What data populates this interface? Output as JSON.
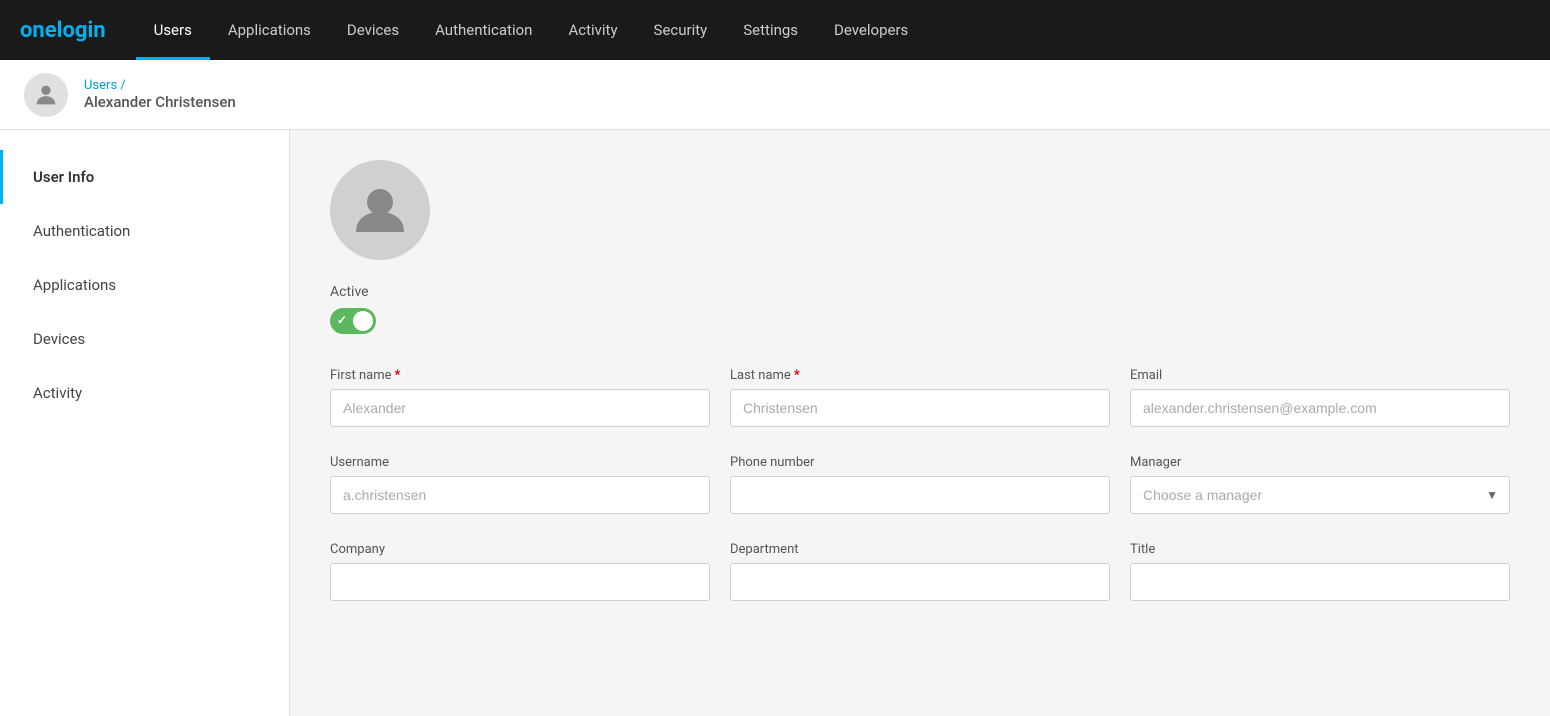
{
  "logo": {
    "text_one": "one",
    "text_two": "login"
  },
  "topnav": {
    "items": [
      {
        "id": "users",
        "label": "Users",
        "active": true
      },
      {
        "id": "applications",
        "label": "Applications",
        "active": false
      },
      {
        "id": "devices",
        "label": "Devices",
        "active": false
      },
      {
        "id": "authentication",
        "label": "Authentication",
        "active": false
      },
      {
        "id": "activity",
        "label": "Activity",
        "active": false
      },
      {
        "id": "security",
        "label": "Security",
        "active": false
      },
      {
        "id": "settings",
        "label": "Settings",
        "active": false
      },
      {
        "id": "developers",
        "label": "Developers",
        "active": false
      }
    ]
  },
  "breadcrumb": {
    "link_label": "Users /",
    "current_user": "Alexander Christensen"
  },
  "sidebar": {
    "items": [
      {
        "id": "user-info",
        "label": "User Info",
        "active": true
      },
      {
        "id": "authentication",
        "label": "Authentication",
        "active": false
      },
      {
        "id": "applications",
        "label": "Applications",
        "active": false
      },
      {
        "id": "devices",
        "label": "Devices",
        "active": false
      },
      {
        "id": "activity",
        "label": "Activity",
        "active": false
      }
    ]
  },
  "form": {
    "active_label": "Active",
    "toggle_on": true,
    "fields": {
      "first_name": {
        "label": "First name",
        "required": true,
        "placeholder": "Alexander",
        "value": "Alexander"
      },
      "last_name": {
        "label": "Last name",
        "required": true,
        "placeholder": "Christensen",
        "value": "Christensen"
      },
      "email": {
        "label": "Email",
        "required": false,
        "placeholder": "alexander.christensen@example.com",
        "value": "alexander.christensen@example.com"
      },
      "username": {
        "label": "Username",
        "required": false,
        "placeholder": "a.christensen",
        "value": "a.christensen"
      },
      "phone_number": {
        "label": "Phone number",
        "required": false,
        "placeholder": "",
        "value": ""
      },
      "manager": {
        "label": "Manager",
        "required": false,
        "placeholder": "Choose a manager"
      },
      "company": {
        "label": "Company",
        "required": false,
        "placeholder": "",
        "value": ""
      },
      "department": {
        "label": "Department",
        "required": false,
        "placeholder": "",
        "value": ""
      },
      "title": {
        "label": "Title",
        "required": false,
        "placeholder": "",
        "value": ""
      }
    }
  }
}
